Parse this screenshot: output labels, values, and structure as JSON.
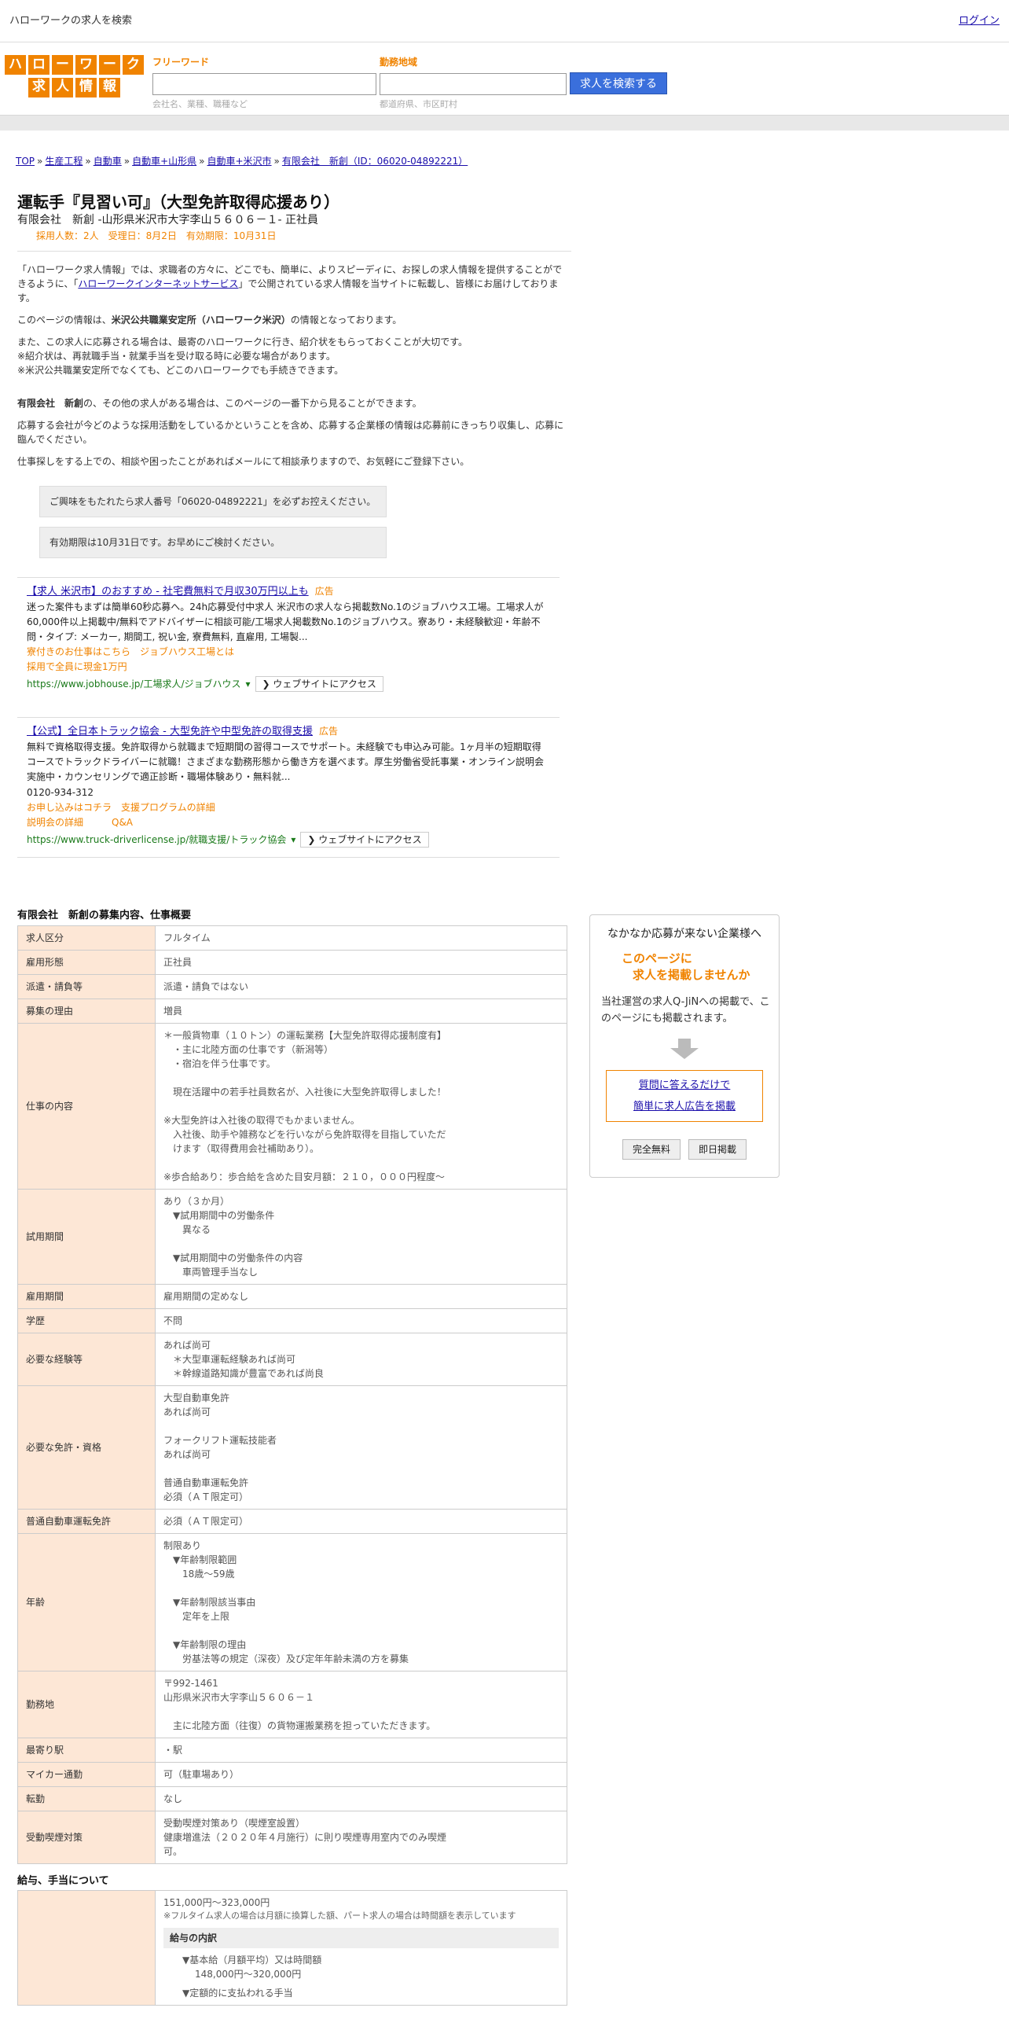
{
  "topbar": {
    "title": "ハローワークの求人を検索",
    "login": "ログイン"
  },
  "logo": {
    "row1": [
      "ハ",
      "ロ",
      "ー",
      "ワ",
      "ー",
      "ク"
    ],
    "row2": [
      "求",
      "人",
      "情",
      "報"
    ]
  },
  "search": {
    "freeword_label": "フリーワード",
    "freeword_hint": "会社名、業種、職種など",
    "area_label": "勤務地域",
    "area_hint": "都道府県、市区町村",
    "button": "求人を検索する"
  },
  "breadcrumb": [
    "TOP",
    "生産工程",
    "自動車",
    "自動車+山形県",
    "自動車+米沢市",
    "有限会社　新創（ID：06020-04892221）"
  ],
  "job": {
    "title": "運転手『見習い可』（大型免許取得応援あり）",
    "sub": "有限会社　新創 -山形県米沢市大字李山５６０６－１- 正社員",
    "meta": "採用人数：2人　受理日：8月2日　有効期限：10月31日"
  },
  "intro": {
    "p1_a": "「ハローワーク求人情報」では、求職者の方々に、どこでも、簡単に、よりスピーディに、お探しの求人情報を提供することができるように、「",
    "p1_link": "ハローワークインターネットサービス",
    "p1_b": "」で公開されている求人情報を当サイトに転載し、皆様にお届けしております。",
    "p2_a": "このページの情報は、",
    "p2_bold": "米沢公共職業安定所（ハローワーク米沢）",
    "p2_b": "の情報となっております。",
    "p3": "また、この求人に応募される場合は、最寄のハローワークに行き、紹介状をもらっておくことが大切です。\n※紹介状は、再就職手当・就業手当を受け取る時に必要な場合があります。\n※米沢公共職業安定所でなくても、どこのハローワークでも手続きできます。",
    "p4_bold": "有限会社　新創",
    "p4": "の、その他の求人がある場合は、このページの一番下から見ることができます。",
    "p5": "応募する会社が今どのような採用活動をしているかということを含め、応募する企業様の情報は応募前にきっちり収集し、応募に臨んでください。",
    "p6": "仕事探しをする上での、相談や困ったことがあればメールにて相談承りますので、お気軽にご登録下さい。"
  },
  "notices": [
    "ご興味をもたれたら求人番号「06020-04892221」を必ずお控えください。",
    "有効期限は10月31日です。お早めにご検討ください。"
  ],
  "ads": [
    {
      "title": "【求人 米沢市】のおすすめ - 社宅費無料で月収30万円以上も",
      "badge": "広告",
      "body": "迷った案件もまずは簡単60秒応募へ。24h応募受付中求人 米沢市の求人なら掲載数No.1のジョブハウス工場。工場求人が60,000件以上掲載中/無料でアドバイザーに相談可能/工場求人掲載数No.1のジョブハウス。寮あり・未経験歓迎・年齢不問・タイプ: メーカー, 期間工, 祝い金, 寮費無料, 直雇用, 工場製...",
      "links": [
        "寮付きのお仕事はこちら　ジョブハウス工場とは",
        "採用で全員に現金1万円"
      ],
      "url": "https://www.jobhouse.jp/工場求人/ジョブハウス",
      "visit": "❯ ウェブサイトにアクセス"
    },
    {
      "title": "【公式】全日本トラック協会 - 大型免許や中型免許の取得支援",
      "badge": "広告",
      "body": "無料で資格取得支援。免許取得から就職まで短期間の習得コースでサポート。未経験でも申込み可能。1ヶ月半の短期取得コースでトラックドライバーに就職！さまざまな勤務形態から働き方を選べます。厚生労働省受託事業・オンライン説明会実施中・カウンセリングで適正診断・職場体験あり・無料就...\n0120-934-312",
      "links": [
        "お申し込みはコチラ　支援プログラムの詳細",
        "説明会の詳細　　　Q&A"
      ],
      "url": "https://www.truck-driverlicense.jp/就職支援/トラック協会",
      "visit": "❯ ウェブサイトにアクセス"
    }
  ],
  "details": {
    "heading": "有限会社　新創の募集内容、仕事概要",
    "rows": [
      {
        "label": "求人区分",
        "value": "フルタイム"
      },
      {
        "label": "雇用形態",
        "value": "正社員"
      },
      {
        "label": "派遣・請負等",
        "value": "派遣・請負ではない"
      },
      {
        "label": "募集の理由",
        "value": "増員"
      },
      {
        "label": "仕事の内容",
        "value": "＊一般貨物車（１０トン）の運転業務【大型免許取得応援制度有】\n　・主に北陸方面の仕事です（新潟等）\n　・宿泊を伴う仕事です。\n\n　現在活躍中の若手社員数名が、入社後に大型免許取得しました！\n\n※大型免許は入社後の取得でもかまいません。\n　入社後、助手や雑務などを行いながら免許取得を目指していただ\n　けます（取得費用会社補助あり）。\n\n※歩合給あり：歩合給を含めた目安月額：２１０，０００円程度～"
      },
      {
        "label": "試用期間",
        "value": "あり（３か月）\n　▼試用期間中の労働条件\n　　異なる\n\n　▼試用期間中の労働条件の内容\n　　車両管理手当なし"
      },
      {
        "label": "雇用期間",
        "value": "雇用期間の定めなし"
      },
      {
        "label": "学歴",
        "value": "不問"
      },
      {
        "label": "必要な経験等",
        "value": "あれば尚可\n　＊大型車運転経験あれば尚可\n　＊幹線道路知識が豊富であれば尚良"
      },
      {
        "label": "必要な免許・資格",
        "value": "大型自動車免許\nあれば尚可\n\nフォークリフト運転技能者\nあれば尚可\n\n普通自動車運転免許\n必須（ＡＴ限定可）"
      },
      {
        "label": "普通自動車運転免許",
        "value": "必須（ＡＴ限定可）"
      },
      {
        "label": "年齢",
        "value": "制限あり\n　▼年齢制限範囲\n　　18歳〜59歳\n\n　▼年齢制限該当事由\n　　定年を上限\n\n　▼年齢制限の理由\n　　労基法等の規定（深夜）及び定年年齢未満の方を募集"
      },
      {
        "label": "勤務地",
        "value": "〒992-1461\n山形県米沢市大字李山５６０６－１\n\n　主に北陸方面（往復）の貨物運搬業務を担っていただきます。"
      },
      {
        "label": "最寄り駅",
        "value": "・駅"
      },
      {
        "label": "マイカー通勤",
        "value": "可（駐車場あり）"
      },
      {
        "label": "転勤",
        "value": "なし"
      },
      {
        "label": "受動喫煙対策",
        "value": "受動喫煙対策あり（喫煙室設置）\n健康増進法（２０２０年４月施行）に則り喫煙専用室内でのみ喫煙\n可。"
      }
    ]
  },
  "salary": {
    "heading": "給与、手当について",
    "range": "151,000円〜323,000円",
    "note": "※フルタイム求人の場合は月額に換算した額、パート求人の場合は時間額を表示しています",
    "inner_title": "給与の内訳",
    "base_label": "▼基本給（月額平均）又は時間額",
    "base_value": "148,000円〜320,000円",
    "fixed_label": "▼定額的に支払われる手当"
  },
  "sidebar": {
    "title": "なかなか応募が来ない企業様へ",
    "catch1": "このページに",
    "catch2": "求人を掲載しませんか",
    "text": "当社運営の求人Q-JiNへの掲載で、このページにも掲載されます。",
    "link1": "質問に答えるだけで",
    "link2": "簡単に求人広告を掲載",
    "btn1": "完全無料",
    "btn2": "即日掲載"
  }
}
